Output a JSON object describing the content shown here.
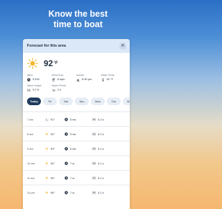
{
  "headline": {
    "line1": "Know the best",
    "line2": "time to boat"
  },
  "card": {
    "title": "Forecast for this area",
    "close_icon": "close-icon",
    "current": {
      "temp": "92",
      "unit": "°F",
      "icon": "sun-icon"
    },
    "stats": [
      {
        "label": "Wind",
        "value": "5 EW",
        "icon": "wind-direction-icon"
      },
      {
        "label": "Wind Gust",
        "value": "8 mph",
        "icon": "wind-gust-icon"
      },
      {
        "label": "Sunset",
        "value": "5:30 pm",
        "icon": "sunset-icon"
      },
      {
        "label": "Water Temp",
        "value": "92 °F",
        "icon": "thermometer-icon"
      },
      {
        "label": "Wave Height",
        "value": "0.2 ft",
        "icon": "wave-icon"
      },
      {
        "label": "Wave Period",
        "value": "2 s",
        "icon": "wave-period-icon"
      }
    ],
    "tabs": [
      "Today",
      "Fri",
      "Sat",
      "Sun",
      "Mon",
      "Tue",
      "Wed"
    ],
    "rows": [
      {
        "time": "7 am",
        "temp": "91°",
        "icon": "cloudy-icon",
        "wind": "5 ew",
        "wave": "0.2 s"
      },
      {
        "time": "8 am",
        "temp": "92°",
        "icon": "sun-icon",
        "wind": "5 ew",
        "wave": "0.2 s"
      },
      {
        "time": "9 am",
        "temp": "93°",
        "icon": "sun-icon",
        "wind": "6 ew",
        "wave": "0.1 s"
      },
      {
        "time": "10 am",
        "temp": "94°",
        "icon": "sun-icon",
        "wind": "7 w",
        "wave": "0.1 s"
      },
      {
        "time": "11 am",
        "temp": "94°",
        "icon": "sun-icon",
        "wind": "7 w",
        "wave": "0.1 s"
      },
      {
        "time": "12 pm",
        "temp": "95°",
        "icon": "sun-icon",
        "wind": "7 w",
        "wave": "0.1 s"
      }
    ]
  }
}
